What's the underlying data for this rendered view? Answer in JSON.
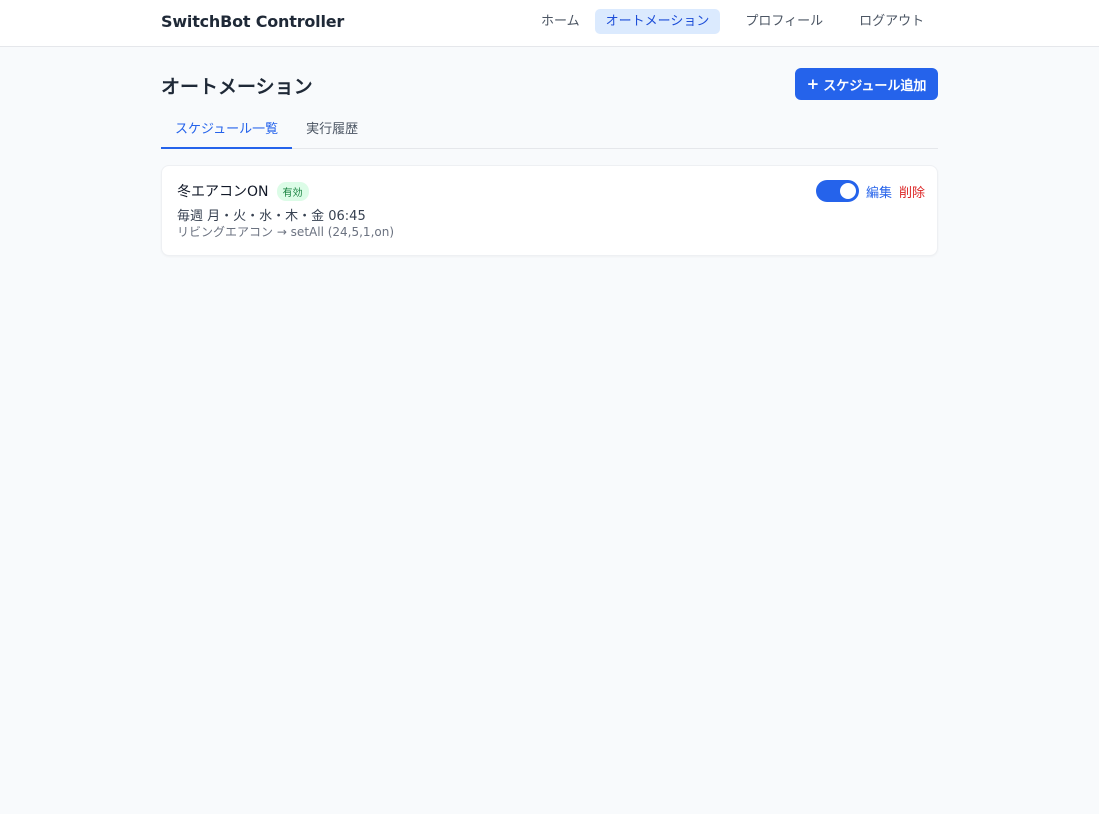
{
  "header": {
    "brand": "SwitchBot Controller",
    "nav": [
      {
        "label": "ホーム"
      },
      {
        "label": "オートメーション",
        "active": true
      },
      {
        "label": "プロフィール"
      },
      {
        "label": "ログアウト"
      }
    ]
  },
  "page": {
    "title": "オートメーション",
    "add_button_icon": "+",
    "add_button_label": "スケジュール追加"
  },
  "tabs": [
    {
      "label": "スケジュール一覧",
      "active": true
    },
    {
      "label": "実行履歴"
    }
  ],
  "schedules": [
    {
      "name": "冬エアコンON",
      "status": "有効",
      "schedule": "毎週 月・火・水・木・金 06:45",
      "action": "リビングエアコン → setAll (24,5,1,on)",
      "enabled": true,
      "edit_label": "編集",
      "delete_label": "削除"
    }
  ],
  "colors": {
    "accent": "#2563eb",
    "danger": "#dc2626",
    "success_text": "#15803d",
    "success_bg": "#dcfce7",
    "nav_active_bg": "#dbeafe"
  }
}
